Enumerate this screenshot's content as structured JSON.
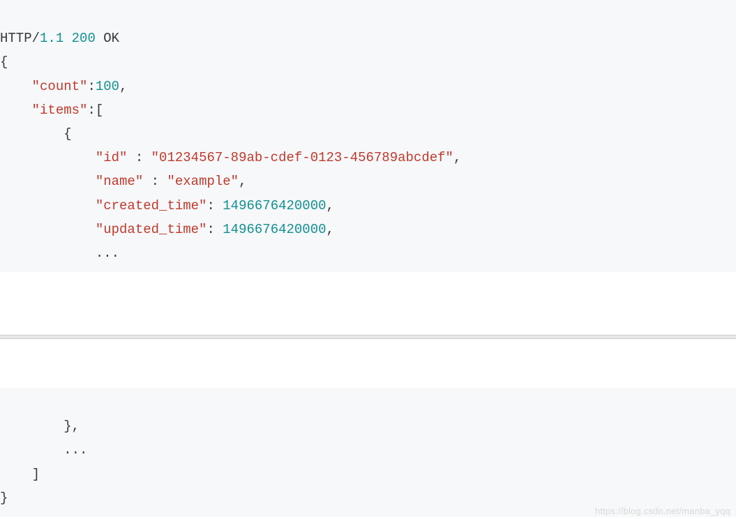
{
  "status_line": {
    "protocol": "HTTP/",
    "version": "1.1",
    "code": "200",
    "reason": "OK"
  },
  "top": {
    "open_brace": "{",
    "indent1": "    ",
    "count_key": "\"count\"",
    "colon": ":",
    "count_val": "100",
    "comma": ",",
    "items_key": "\"items\"",
    "open_bracket": "[",
    "indent2": "        ",
    "open_brace2": "{",
    "indent3": "            ",
    "id_key": "\"id\"",
    "sp_colon_sp": " : ",
    "id_val": "\"01234567-89ab-cdef-0123-456789abcdef\"",
    "name_key": "\"name\"",
    "name_val": "\"example\"",
    "ct_key": "\"created_time\"",
    "colon_sp": ": ",
    "ct_val": "1496676420000",
    "ut_key": "\"updated_time\"",
    "ut_val": "1496676420000",
    "ellipsis": "..."
  },
  "bottom": {
    "indent2": "        ",
    "close_brace_item": "},",
    "ellipsis": "...",
    "indent1": "    ",
    "close_bracket": "]",
    "close_brace": "}"
  },
  "watermark": "https://blog.csdn.net/manba_yqq"
}
